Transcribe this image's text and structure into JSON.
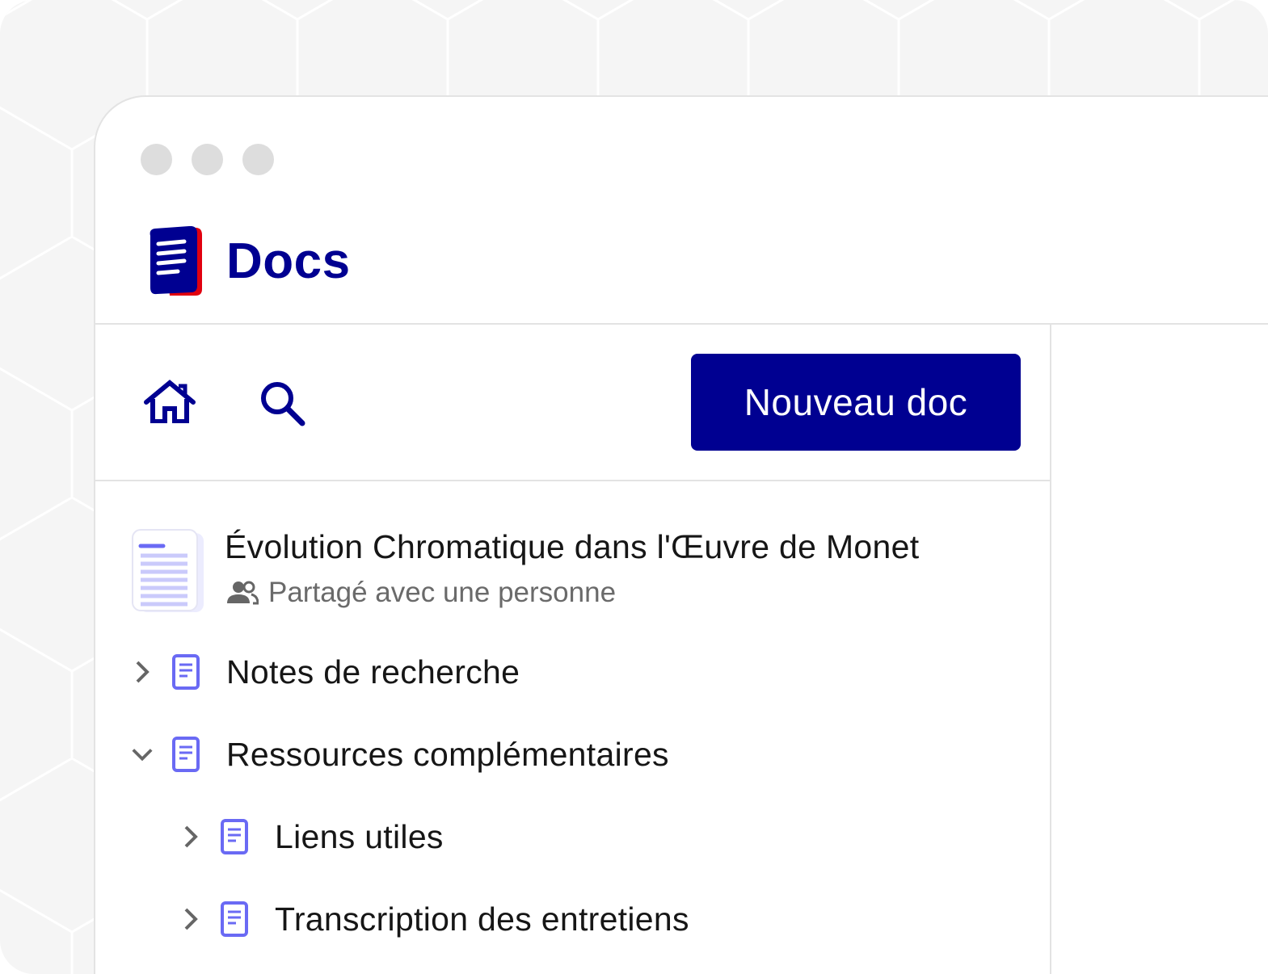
{
  "app": {
    "name": "Docs",
    "brand_color": "#000091",
    "logo_icon": "docs-logo-icon"
  },
  "window": {
    "traffic_lights": [
      "close-dot",
      "minimize-dot",
      "maximize-dot"
    ]
  },
  "toolbar": {
    "home_icon": "home-icon",
    "search_icon": "search-icon",
    "new_doc_label": "Nouveau doc"
  },
  "document": {
    "title": "Évolution Chromatique dans l'Œuvre de Monet",
    "share_icon": "people-icon",
    "share_status": "Partagé avec une personne"
  },
  "tree": {
    "items": [
      {
        "label": "Notes de recherche",
        "expanded": false,
        "depth": 0,
        "icon": "page-icon"
      },
      {
        "label": "Ressources complémentaires",
        "expanded": true,
        "depth": 0,
        "icon": "page-icon"
      },
      {
        "label": "Liens utiles",
        "expanded": false,
        "depth": 1,
        "icon": "page-icon"
      },
      {
        "label": "Transcription des entretiens",
        "expanded": false,
        "depth": 1,
        "icon": "page-icon"
      }
    ]
  }
}
